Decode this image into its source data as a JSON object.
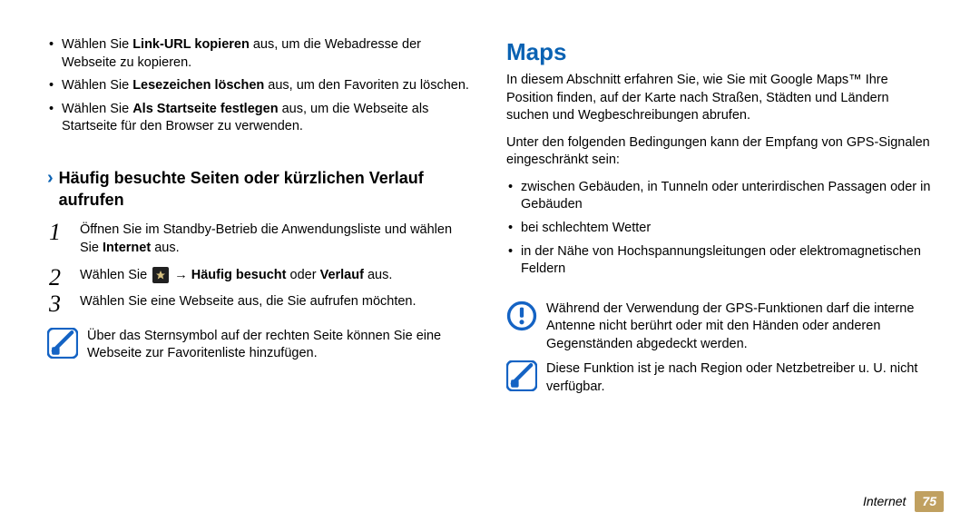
{
  "left": {
    "bullets": [
      {
        "pre": "Wählen Sie ",
        "bold": "Link-URL kopieren",
        "post": " aus, um die Webadresse der Webseite zu kopieren."
      },
      {
        "pre": "Wählen Sie ",
        "bold": "Lesezeichen löschen",
        "post": " aus, um den Favoriten zu löschen."
      },
      {
        "pre": "Wählen Sie ",
        "bold": "Als Startseite festlegen",
        "post": " aus, um die Webseite als Startseite für den Browser zu verwenden."
      }
    ],
    "section_title": "Häufig besuchte Seiten oder kürzlichen Verlauf aufrufen",
    "steps": {
      "s1_a": "Öffnen Sie im Standby-Betrieb die Anwendungsliste und wählen Sie ",
      "s1_bold": "Internet",
      "s1_c": " aus.",
      "s2_a": "Wählen Sie ",
      "s2_arrow": " → ",
      "s2_bold": "Häufig besucht",
      "s2_mid": " oder ",
      "s2_bold2": "Verlauf",
      "s2_end": " aus.",
      "s3": "Wählen Sie eine Webseite aus, die Sie aufrufen möchten."
    },
    "note": "Über das Sternsymbol auf der rechten Seite können Sie eine Webseite zur Favoritenliste hinzufügen."
  },
  "right": {
    "title": "Maps",
    "intro": "In diesem Abschnitt erfahren Sie, wie Sie mit Google Maps™ Ihre Position finden, auf der Karte nach Straßen, Städten und Ländern suchen und Wegbeschreibungen abrufen.",
    "gps_intro": "Unter den folgenden Bedingungen kann der Empfang von GPS-Signalen eingeschränkt sein:",
    "gps_bullets": [
      "zwischen Gebäuden, in Tunneln oder unterirdischen Passagen oder in Gebäuden",
      "bei schlechtem Wetter",
      "in der Nähe von Hochspannungsleitungen oder elektromagnetischen Feldern"
    ],
    "warn": "Während der Verwendung der GPS-Funktionen darf die interne Antenne nicht berührt oder mit den Händen oder anderen Gegenständen abgedeckt werden.",
    "note": "Diese Funktion ist je nach Region oder Netzbetreiber u. U. nicht verfügbar."
  },
  "footer": {
    "section": "Internet",
    "page": "75"
  },
  "chart_data": {
    "type": "table",
    "note": "not a chart"
  }
}
